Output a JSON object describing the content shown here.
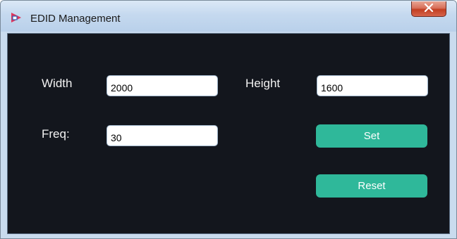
{
  "window": {
    "title": "EDID Management",
    "app_icon": "edid-app-icon",
    "close_icon": "close-icon"
  },
  "form": {
    "width": {
      "label": "Width",
      "value": "2000"
    },
    "height": {
      "label": "Height",
      "value": "1600"
    },
    "freq": {
      "label": "Freq:",
      "value": "30"
    }
  },
  "buttons": {
    "set_label": "Set",
    "reset_label": "Reset"
  },
  "colors": {
    "client_background": "#13161d",
    "button_accent": "#2fb89a",
    "close_button": "#c23e22"
  }
}
